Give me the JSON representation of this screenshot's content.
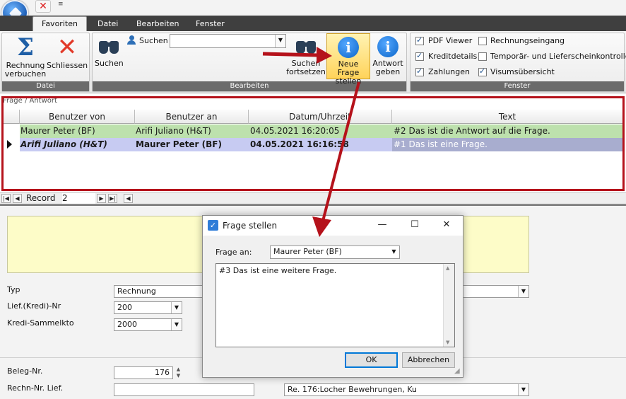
{
  "qat": {
    "more_glyph": "≡"
  },
  "tabs": [
    {
      "label": "Favoriten",
      "active": true
    },
    {
      "label": "Datei"
    },
    {
      "label": "Bearbeiten"
    },
    {
      "label": "Fenster"
    }
  ],
  "ribbon": {
    "groups": {
      "datei": "Datei",
      "bearbeiten": "Bearbeiten",
      "fenster": "Fenster"
    },
    "buttons": {
      "rechnung_verbuchen_1": "Rechnung",
      "rechnung_verbuchen_2": "verbuchen",
      "schliessen": "Schliessen",
      "suchen": "Suchen",
      "suchen_label": "Suchen",
      "suchen_fortsetzen_1": "Suchen",
      "suchen_fortsetzen_2": "fortsetzen",
      "neue_frage_1": "Neue Frage",
      "neue_frage_2": "stellen",
      "antwort_1": "Antwort",
      "antwort_2": "geben"
    },
    "search_value": "",
    "fenster_checks": [
      {
        "label": "PDF Viewer",
        "checked": true
      },
      {
        "label": "Rechnungseingang",
        "checked": false
      },
      {
        "label": "Kreditdetails",
        "checked": true
      },
      {
        "label": "Temporär- und Lieferscheinkontrolle",
        "checked": false
      },
      {
        "label": "Zahlungen",
        "checked": true
      },
      {
        "label": "Visumsübersicht",
        "checked": true
      }
    ]
  },
  "grid": {
    "caption": "Frage / Antwort",
    "columns": [
      "Benutzer von",
      "Benutzer an",
      "Datum/Uhrzeit",
      "Text"
    ],
    "rows": [
      {
        "von": "Maurer Peter (BF)",
        "an": "Arifi Juliano (H&T)",
        "datum": "04.05.2021 16:20:05",
        "text": "#2 Das ist die Antwort auf die Frage.",
        "current": false
      },
      {
        "von": "Arifi Juliano (H&T)",
        "an": "Maurer Peter (BF)",
        "datum": "04.05.2021 16:16:58",
        "text": "#1 Das ist eine Frage.",
        "current": true
      }
    ],
    "nav": {
      "label": "Record",
      "value": "2"
    }
  },
  "form": {
    "typ_label": "Typ",
    "typ_value": "Rechnung",
    "lief_label": "Lief.(Kredi)-Nr",
    "lief_value": "200",
    "sammel_label": "Kredi-Sammelkto",
    "sammel_value": "2000",
    "beleg_label": "Beleg-Nr.",
    "beleg_value": "176",
    "rechn_label": "Rechn-Nr. Lief.",
    "rechn_value": "",
    "re_value": "Re. 176:Locher Bewehrungen, Ku"
  },
  "dialog": {
    "title": "Frage stellen",
    "frage_an_label": "Frage an:",
    "frage_an_value": "Maurer Peter (BF)",
    "text": "#3 Das ist eine weitere Frage.",
    "ok": "OK",
    "cancel": "Abbrechen"
  },
  "colors": {
    "annotation_red": "#b5121b",
    "row_green": "#bde1ad",
    "row_selected": "#c7cbf2"
  }
}
